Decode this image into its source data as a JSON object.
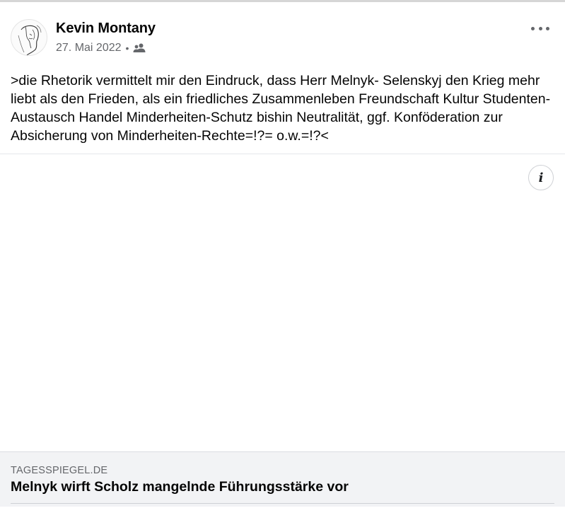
{
  "post": {
    "author": "Kevin Montany",
    "date": "27. Mai 2022",
    "separator": "•",
    "audience_icon": "friends-icon",
    "more_icon": "more-options-icon",
    "text": ">die Rhetorik vermittelt mir den Eindruck, dass Herr Melnyk- Selenskyj den Krieg mehr liebt als den Frieden, als ein friedliches Zusammenleben Freundschaft Kultur Studenten-Austausch Handel Minderheiten-Schutz bishin Neutralität, ggf. Konföderation zur Absicherung von Minderheiten-Rechte=!?= o.w.=!?<"
  },
  "media": {
    "info_icon": "info-icon",
    "info_label": "i"
  },
  "link": {
    "domain": "TAGESSPIEGEL.DE",
    "title": "Melnyk wirft Scholz mangelnde Führungsstärke vor"
  },
  "colors": {
    "text": "#050505",
    "secondary": "#65676b",
    "card_bg": "#f2f3f5",
    "divider": "#e4e6eb"
  }
}
